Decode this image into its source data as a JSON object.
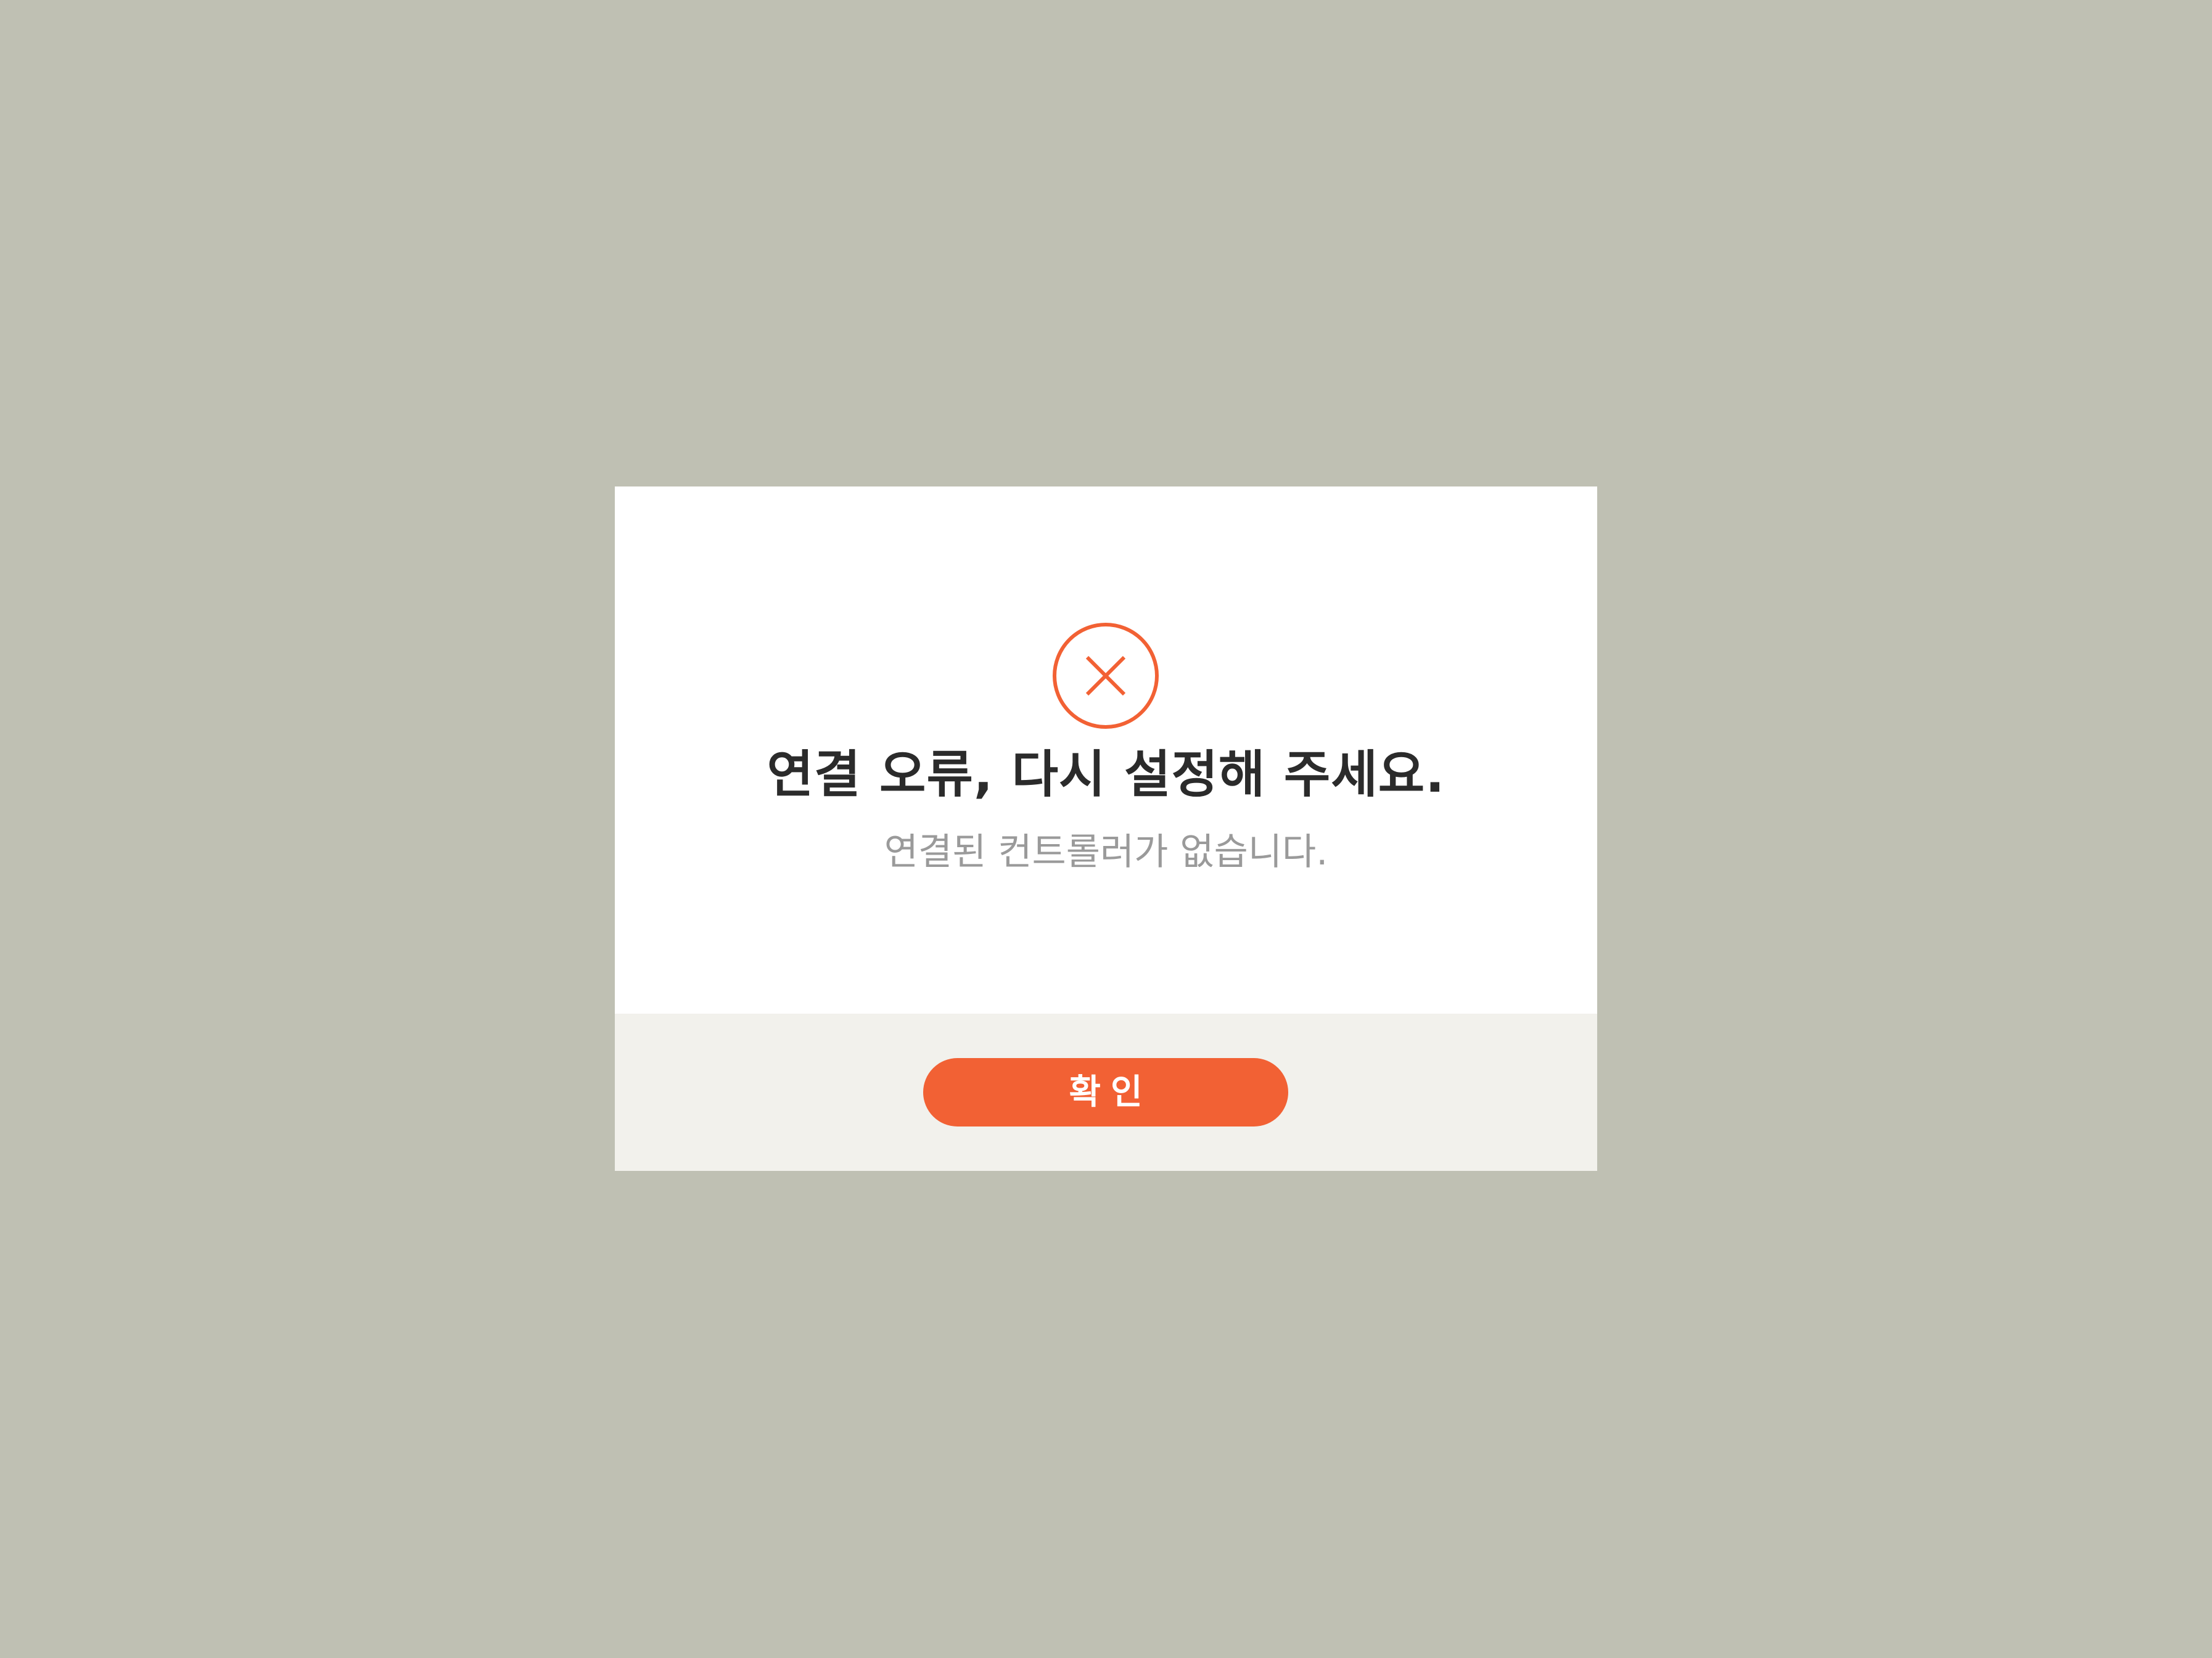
{
  "dialog": {
    "icon": "error-x-circle-icon",
    "title": "연결 오류, 다시 설정해 주세요.",
    "message": "연결된 컨트롤러가 없습니다.",
    "confirm_label": "확인"
  },
  "colors": {
    "backdrop": "#bfc0b3",
    "accent": "#f26134",
    "title_text": "#2b2b2b",
    "message_text": "#9a9a9a",
    "footer_background": "#f2f1ec"
  }
}
